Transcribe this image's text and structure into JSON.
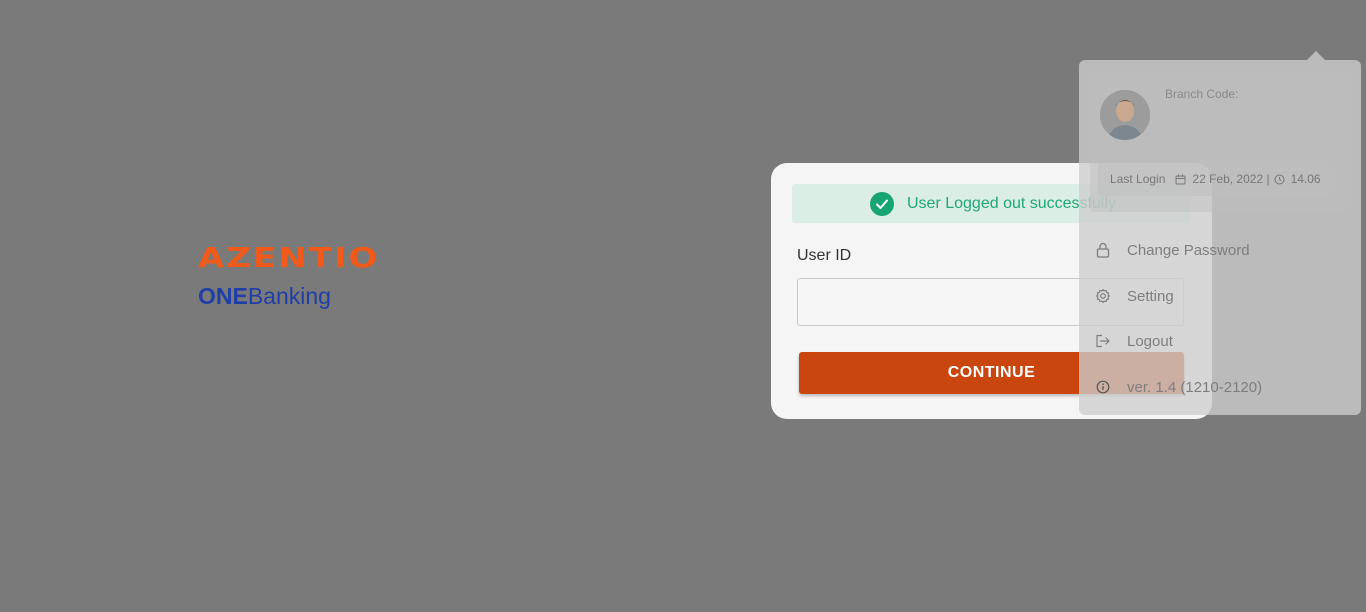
{
  "brand": {
    "logo_name": "AZENTIO",
    "product_prefix": "ONE",
    "product_suffix": "Banking",
    "colors": {
      "logo_orange": "#f05a1a",
      "product_blue": "#1f3fa6"
    }
  },
  "login": {
    "alert_message": "User Logged out successfully",
    "user_id_label": "User ID",
    "user_id_value": "",
    "continue_label": "CONTINUE",
    "colors": {
      "button": "#c9460f",
      "alert_text": "#1fa876",
      "alert_bg": "#dbeee6"
    }
  },
  "user_menu": {
    "branch_code_label": "Branch Code:",
    "last_login_label": "Last Login",
    "last_login_date": "22 Feb, 2022 |",
    "last_login_time": "14.06",
    "items": [
      {
        "label": "Change Password",
        "icon": "lock-icon"
      },
      {
        "label": "Setting",
        "icon": "gear-icon"
      },
      {
        "label": "Logout",
        "icon": "logout-icon"
      }
    ],
    "version": "ver. 1.4 (1210-2120)"
  }
}
